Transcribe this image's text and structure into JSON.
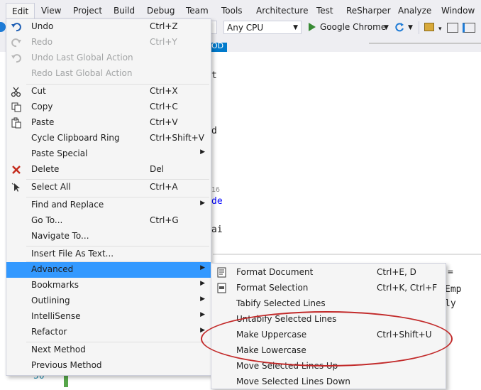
{
  "menubar": {
    "items": [
      "Edit",
      "View",
      "Project",
      "Build",
      "Debug",
      "Team",
      "Tools",
      "Architecture",
      "Test",
      "ReSharper",
      "Analyze",
      "Window"
    ]
  },
  "toolbar": {
    "platform": "Any CPU",
    "browser": "Google Chrome"
  },
  "editor": {
    "tab_fragment": "OD",
    "code_fragments": [
      "t",
      "d",
      "16",
      "de",
      "ai",
      "=",
      "Emp",
      "ly"
    ],
    "line_number": "50"
  },
  "edit_menu": {
    "items": [
      {
        "label": "Undo",
        "shortcut": "Ctrl+Z",
        "icon": "undo-icon",
        "disabled": false
      },
      {
        "label": "Redo",
        "shortcut": "Ctrl+Y",
        "icon": "redo-icon",
        "disabled": true
      },
      {
        "label": "Undo Last Global Action",
        "shortcut": "",
        "icon": "undo-global-icon",
        "disabled": true
      },
      {
        "label": "Redo Last Global Action",
        "shortcut": "",
        "icon": "",
        "disabled": true
      },
      {
        "label": "Cut",
        "shortcut": "Ctrl+X",
        "icon": "scissors-icon",
        "disabled": false
      },
      {
        "label": "Copy",
        "shortcut": "Ctrl+C",
        "icon": "copy-icon",
        "disabled": false
      },
      {
        "label": "Paste",
        "shortcut": "Ctrl+V",
        "icon": "paste-icon",
        "disabled": false
      },
      {
        "label": "Cycle Clipboard Ring",
        "shortcut": "Ctrl+Shift+V",
        "icon": "",
        "disabled": false
      },
      {
        "label": "Paste Special",
        "shortcut": "",
        "icon": "",
        "disabled": false,
        "submenu": true
      },
      {
        "label": "Delete",
        "shortcut": "Del",
        "icon": "delete-x-icon",
        "disabled": false
      },
      {
        "label": "Select All",
        "shortcut": "Ctrl+A",
        "icon": "select-all-icon",
        "disabled": false
      },
      {
        "label": "Find and Replace",
        "shortcut": "",
        "icon": "",
        "disabled": false,
        "submenu": true
      },
      {
        "label": "Go To...",
        "shortcut": "Ctrl+G",
        "icon": "",
        "disabled": false
      },
      {
        "label": "Navigate To...",
        "shortcut": "",
        "icon": "",
        "disabled": false
      },
      {
        "label": "Insert File As Text...",
        "shortcut": "",
        "icon": "",
        "disabled": false
      },
      {
        "label": "Advanced",
        "shortcut": "",
        "icon": "",
        "disabled": false,
        "submenu": true,
        "highlighted": true
      },
      {
        "label": "Bookmarks",
        "shortcut": "",
        "icon": "",
        "disabled": false,
        "submenu": true
      },
      {
        "label": "Outlining",
        "shortcut": "",
        "icon": "",
        "disabled": false,
        "submenu": true
      },
      {
        "label": "IntelliSense",
        "shortcut": "",
        "icon": "",
        "disabled": false,
        "submenu": true
      },
      {
        "label": "Refactor",
        "shortcut": "",
        "icon": "",
        "disabled": false,
        "submenu": true
      },
      {
        "label": "Next Method",
        "shortcut": "",
        "icon": "",
        "disabled": false
      },
      {
        "label": "Previous Method",
        "shortcut": "",
        "icon": "",
        "disabled": false
      }
    ]
  },
  "advanced_menu": {
    "items": [
      {
        "label": "Format Document",
        "shortcut": "Ctrl+E, D",
        "icon": "format-document-icon"
      },
      {
        "label": "Format Selection",
        "shortcut": "Ctrl+K, Ctrl+F",
        "icon": "format-selection-icon"
      },
      {
        "label": "Tabify Selected Lines",
        "shortcut": "",
        "icon": ""
      },
      {
        "label": "Untabify Selected Lines",
        "shortcut": "",
        "icon": ""
      },
      {
        "label": "Make Uppercase",
        "shortcut": "Ctrl+Shift+U",
        "icon": ""
      },
      {
        "label": "Make Lowercase",
        "shortcut": "",
        "icon": ""
      },
      {
        "label": "Move Selected Lines Up",
        "shortcut": "",
        "icon": ""
      },
      {
        "label": "Move Selected Lines Down",
        "shortcut": "",
        "icon": ""
      }
    ]
  },
  "colors": {
    "highlight": "#3399ff",
    "annotation_oval": "#c22a2a",
    "menu_bg": "#f5f5f5"
  }
}
